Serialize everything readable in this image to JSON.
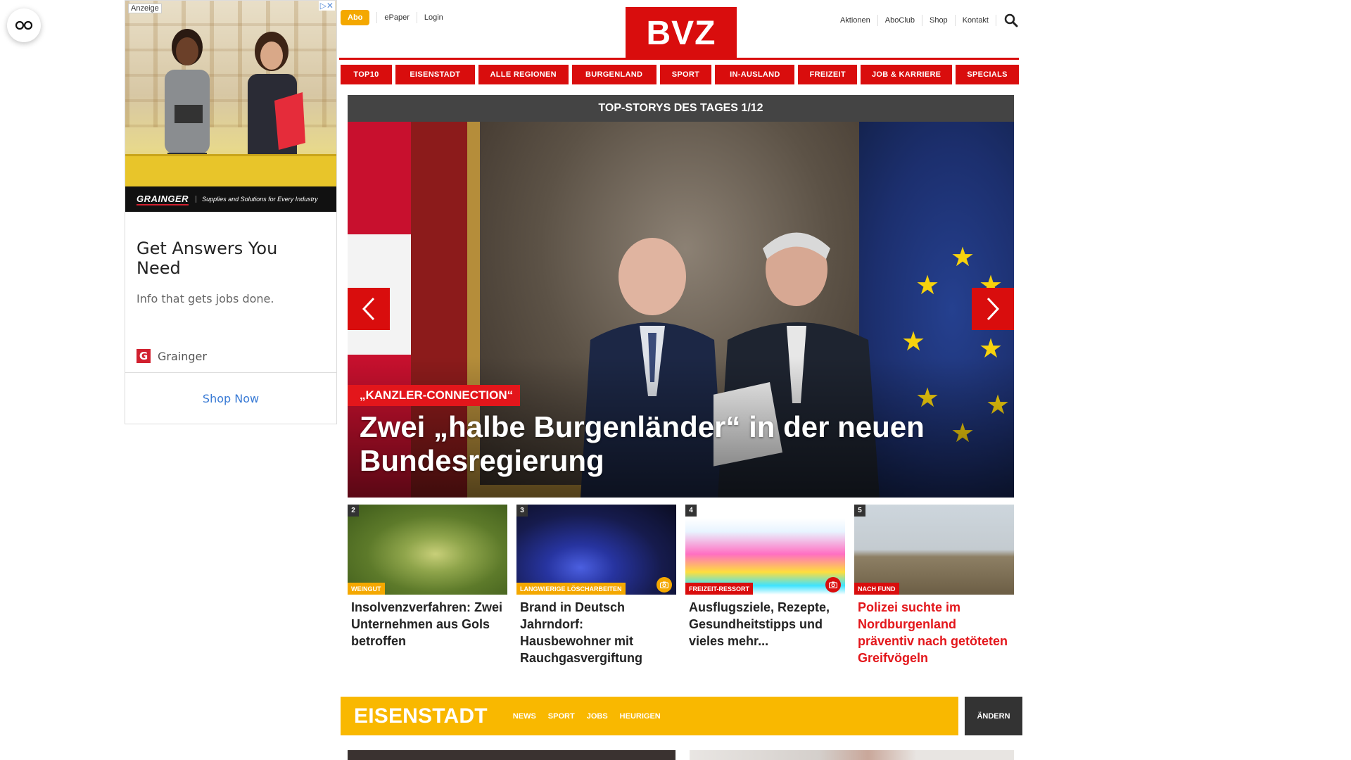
{
  "ad": {
    "label": "Anzeige",
    "close": "▷✕",
    "brand": "GRAINGER",
    "brand_tagline": "Supplies and Solutions for Every Industry",
    "headline": "Get Answers You Need",
    "subtext": "Info that gets jobs done.",
    "advertiser": "Grainger",
    "advertiser_logo": "G",
    "cta": "Shop Now"
  },
  "header": {
    "abo": "Abo",
    "epaper": "ePaper",
    "login": "Login",
    "logo": "BVZ",
    "aktionen": "Aktionen",
    "aboclub": "AboClub",
    "shop": "Shop",
    "kontakt": "Kontakt"
  },
  "nav": [
    {
      "label": "TOP10",
      "width": 73
    },
    {
      "label": "EISENSTADT",
      "width": 113
    },
    {
      "label": "ALLE REGIONEN",
      "width": 128
    },
    {
      "label": "BURGENLAND",
      "width": 120
    },
    {
      "label": "SPORT",
      "width": 74
    },
    {
      "label": "IN-AUSLAND",
      "width": 113
    },
    {
      "label": "FREIZEIT",
      "width": 84
    },
    {
      "label": "JOB & KARRIERE",
      "width": 130
    },
    {
      "label": "SPECIALS",
      "width": 90
    }
  ],
  "top_stories": {
    "header": "TOP-STORYS DES TAGES 1/12",
    "kicker": "„KANZLER-CONNECTION“",
    "title": "Zwei „halbe Burgenländer“ in der neuen Bundesregierung"
  },
  "teasers": [
    {
      "num": "2",
      "tag": "WEINGUT",
      "tag_color": "yellow",
      "title": "Insolvenzverfahren: Zwei Unternehmen aus Gols betroffen",
      "title_red": false,
      "camera": false
    },
    {
      "num": "3",
      "tag": "LANGWIERIGE LÖSCHARBEITEN",
      "tag_color": "yellow",
      "title": "Brand in Deutsch Jahrndorf: Hausbewohner mit Rauchgasvergiftung",
      "title_red": false,
      "camera": true
    },
    {
      "num": "4",
      "tag": "FREIZEIT-RESSORT",
      "tag_color": "red",
      "title": "Ausflugsziele, Rezepte, Gesundheitstipps und vieles mehr...",
      "title_red": false,
      "camera": true
    },
    {
      "num": "5",
      "tag": "NACH FUND",
      "tag_color": "red",
      "title": "Polizei suchte im Nordburgenland präventiv nach getöteten Greifvögeln",
      "title_red": true,
      "camera": false
    }
  ],
  "region": {
    "name": "EISENSTADT",
    "links": [
      "NEWS",
      "SPORT",
      "JOBS",
      "HEURIGEN"
    ],
    "change": "ÄNDERN"
  },
  "colors": {
    "brand_red": "#d90d0d",
    "accent_yellow": "#f9b800",
    "dark": "#333333"
  }
}
